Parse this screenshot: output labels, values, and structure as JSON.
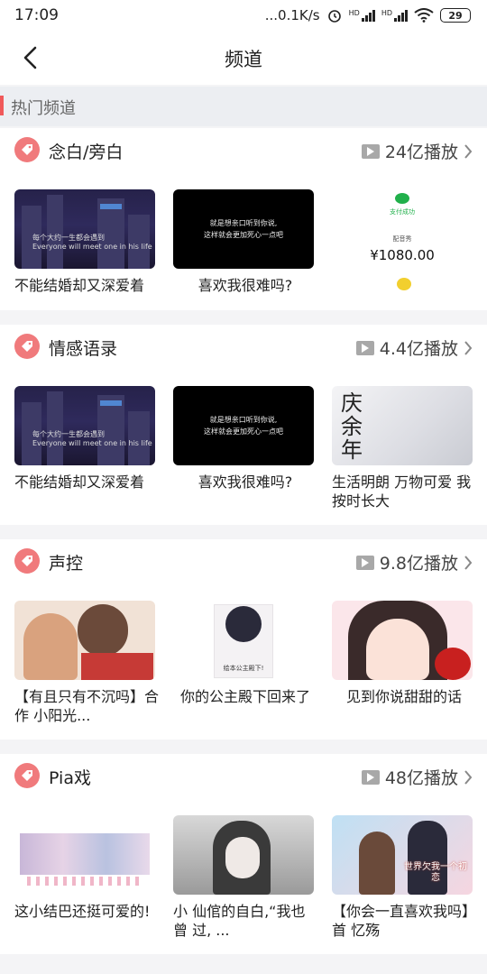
{
  "status_bar": {
    "time": "17:09",
    "network": "...0.1K/s",
    "hd1": "HD",
    "hd2": "HD",
    "battery": "29"
  },
  "nav": {
    "title": "频道"
  },
  "hot": {
    "label": "热门频道"
  },
  "sections": [
    {
      "title": "念白/旁白",
      "plays": "24亿播放",
      "cards": [
        {
          "caption": "不能结婚却又深爱着",
          "thumb_text": "每个大约一生都会遇到\nEveryone will meet one in his life"
        },
        {
          "caption": "喜欢我很难吗?",
          "thumb_text": "就是想亲口听到你说,\n这样就会更加死心一点吧"
        },
        {
          "caption": "",
          "pay_status": "支付成功",
          "pay_sub": "配音秀",
          "amount": "¥1080.00"
        }
      ]
    },
    {
      "title": "情感语录",
      "plays": "4.4亿播放",
      "cards": [
        {
          "caption": "不能结婚却又深爱着",
          "thumb_text": "每个大约一生都会遇到\nEveryone will meet one in his life"
        },
        {
          "caption": "喜欢我很难吗?",
          "thumb_text": "就是想亲口听到你说,\n这样就会更加死心一点吧"
        },
        {
          "caption": "生活明朗 万物可爱 我按时长大",
          "thumb_text": "庆余年"
        }
      ]
    },
    {
      "title": "声控",
      "plays": "9.8亿播放",
      "cards": [
        {
          "caption": "【有且只有不沉吗】合作 小阳光..."
        },
        {
          "caption": "你的公主殿下回来了",
          "thumb_text": "绘本公主殿下!"
        },
        {
          "caption": "见到你说甜甜的话"
        }
      ]
    },
    {
      "title": "Pia戏",
      "plays": "48亿播放",
      "cards": [
        {
          "caption": "这小结巴还挺可爱的!"
        },
        {
          "caption": "小 仙倌的自白,“我也曾 过, ..."
        },
        {
          "caption": "【你会一直喜欢我吗】首 忆殇",
          "thumb_text": "世界欠我一个初恋"
        }
      ]
    }
  ]
}
